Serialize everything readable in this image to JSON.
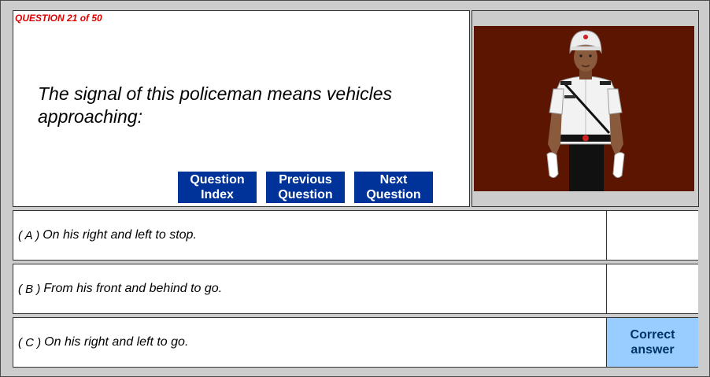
{
  "question": {
    "counter": "QUESTION 21 of 50",
    "text": "The signal of this policeman means vehicles approaching:"
  },
  "nav": {
    "index_label": "Question\nIndex",
    "previous_label": "Previous\nQuestion",
    "next_label": "Next\nQuestion"
  },
  "answers": [
    {
      "letter": "( A )",
      "text": "On his right and left to stop.",
      "status": ""
    },
    {
      "letter": "( B )",
      "text": "From his front and behind to go.",
      "status": ""
    },
    {
      "letter": "( C )",
      "text": "On his right and left to go.",
      "status": "Correct\nanswer"
    }
  ],
  "colors": {
    "nav_button": "#003399",
    "correct_highlight": "#99ccff",
    "counter_text": "#e00000",
    "image_background": "#5c1500"
  },
  "image": {
    "icon": "traffic-policeman-illustration"
  }
}
